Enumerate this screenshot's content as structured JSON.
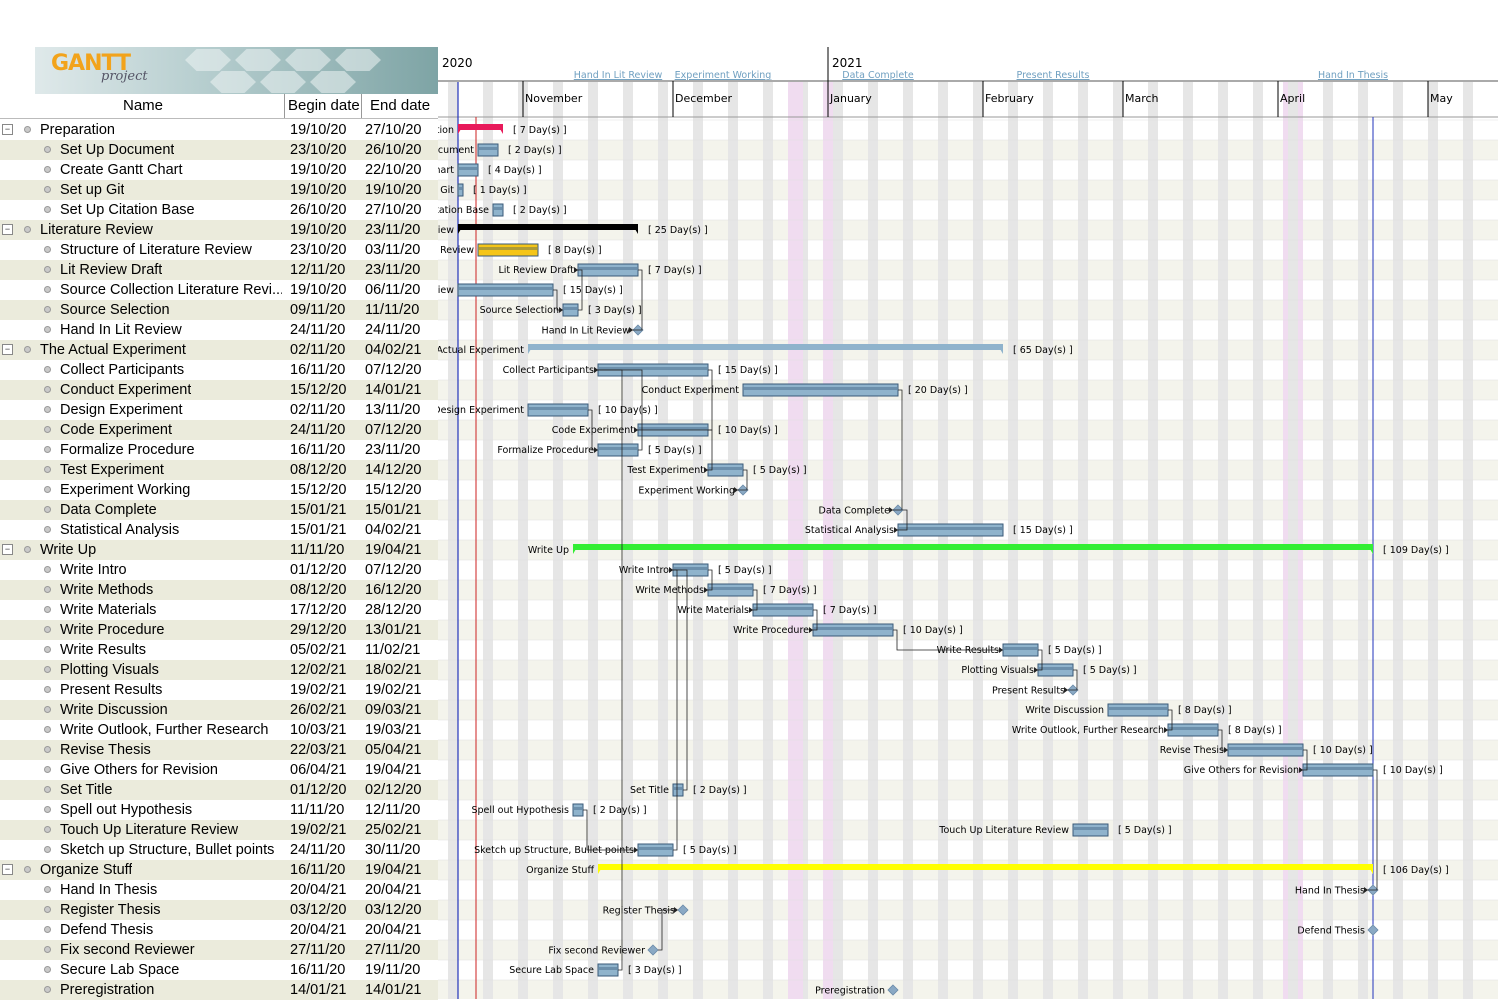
{
  "logo": {
    "word1": "GANTT",
    "word2": "project"
  },
  "table": {
    "headers": {
      "name": "Name",
      "begin": "Begin date",
      "end": "End date"
    },
    "rows": [
      {
        "level": 0,
        "name": "Preparation",
        "begin": "19/10/20",
        "end": "27/10/20"
      },
      {
        "level": 1,
        "name": "Set Up Document",
        "begin": "23/10/20",
        "end": "26/10/20"
      },
      {
        "level": 1,
        "name": "Create Gantt Chart",
        "begin": "19/10/20",
        "end": "22/10/20"
      },
      {
        "level": 1,
        "name": "Set up Git",
        "begin": "19/10/20",
        "end": "19/10/20"
      },
      {
        "level": 1,
        "name": "Set Up Citation Base",
        "begin": "26/10/20",
        "end": "27/10/20"
      },
      {
        "level": 0,
        "name": "Literature Review",
        "begin": "19/10/20",
        "end": "23/11/20"
      },
      {
        "level": 1,
        "name": "Structure of Literature Review",
        "begin": "23/10/20",
        "end": "03/11/20"
      },
      {
        "level": 1,
        "name": "Lit Review Draft",
        "begin": "12/11/20",
        "end": "23/11/20"
      },
      {
        "level": 1,
        "name": "Source Collection Literature Revi...",
        "begin": "19/10/20",
        "end": "06/11/20"
      },
      {
        "level": 1,
        "name": "Source Selection",
        "begin": "09/11/20",
        "end": "11/11/20"
      },
      {
        "level": 1,
        "name": "Hand In Lit Review",
        "begin": "24/11/20",
        "end": "24/11/20"
      },
      {
        "level": 0,
        "name": "The Actual Experiment",
        "begin": "02/11/20",
        "end": "04/02/21"
      },
      {
        "level": 1,
        "name": "Collect Participants",
        "begin": "16/11/20",
        "end": "07/12/20"
      },
      {
        "level": 1,
        "name": "Conduct Experiment",
        "begin": "15/12/20",
        "end": "14/01/21"
      },
      {
        "level": 1,
        "name": "Design Experiment",
        "begin": "02/11/20",
        "end": "13/11/20"
      },
      {
        "level": 1,
        "name": "Code Experiment",
        "begin": "24/11/20",
        "end": "07/12/20"
      },
      {
        "level": 1,
        "name": "Formalize Procedure",
        "begin": "16/11/20",
        "end": "23/11/20"
      },
      {
        "level": 1,
        "name": "Test Experiment",
        "begin": "08/12/20",
        "end": "14/12/20"
      },
      {
        "level": 1,
        "name": "Experiment Working",
        "begin": "15/12/20",
        "end": "15/12/20"
      },
      {
        "level": 1,
        "name": "Data Complete",
        "begin": "15/01/21",
        "end": "15/01/21"
      },
      {
        "level": 1,
        "name": "Statistical Analysis",
        "begin": "15/01/21",
        "end": "04/02/21"
      },
      {
        "level": 0,
        "name": "Write Up",
        "begin": "11/11/20",
        "end": "19/04/21"
      },
      {
        "level": 1,
        "name": "Write Intro",
        "begin": "01/12/20",
        "end": "07/12/20"
      },
      {
        "level": 1,
        "name": "Write Methods",
        "begin": "08/12/20",
        "end": "16/12/20"
      },
      {
        "level": 1,
        "name": "Write Materials",
        "begin": "17/12/20",
        "end": "28/12/20"
      },
      {
        "level": 1,
        "name": "Write Procedure",
        "begin": "29/12/20",
        "end": "13/01/21"
      },
      {
        "level": 1,
        "name": "Write Results",
        "begin": "05/02/21",
        "end": "11/02/21"
      },
      {
        "level": 1,
        "name": "Plotting Visuals",
        "begin": "12/02/21",
        "end": "18/02/21"
      },
      {
        "level": 1,
        "name": "Present Results",
        "begin": "19/02/21",
        "end": "19/02/21"
      },
      {
        "level": 1,
        "name": "Write Discussion",
        "begin": "26/02/21",
        "end": "09/03/21"
      },
      {
        "level": 1,
        "name": "Write Outlook, Further Research",
        "begin": "10/03/21",
        "end": "19/03/21"
      },
      {
        "level": 1,
        "name": "Revise Thesis",
        "begin": "22/03/21",
        "end": "05/04/21"
      },
      {
        "level": 1,
        "name": "Give Others for Revision",
        "begin": "06/04/21",
        "end": "19/04/21"
      },
      {
        "level": 1,
        "name": "Set Title",
        "begin": "01/12/20",
        "end": "02/12/20"
      },
      {
        "level": 1,
        "name": "Spell out Hypothesis",
        "begin": "11/11/20",
        "end": "12/11/20"
      },
      {
        "level": 1,
        "name": "Touch Up Literature Review",
        "begin": "19/02/21",
        "end": "25/02/21"
      },
      {
        "level": 1,
        "name": "Sketch up Structure, Bullet points",
        "begin": "24/11/20",
        "end": "30/11/20"
      },
      {
        "level": 0,
        "name": "Organize Stuff",
        "begin": "16/11/20",
        "end": "19/04/21"
      },
      {
        "level": 1,
        "name": "Hand In Thesis",
        "begin": "20/04/21",
        "end": "20/04/21"
      },
      {
        "level": 1,
        "name": "Register Thesis",
        "begin": "03/12/20",
        "end": "03/12/20"
      },
      {
        "level": 1,
        "name": "Defend Thesis",
        "begin": "20/04/21",
        "end": "20/04/21"
      },
      {
        "level": 1,
        "name": "Fix second Reviewer",
        "begin": "27/11/20",
        "end": "27/11/20"
      },
      {
        "level": 1,
        "name": "Secure Lab Space",
        "begin": "16/11/20",
        "end": "19/11/20"
      },
      {
        "level": 1,
        "name": "Preregistration",
        "begin": "14/01/21",
        "end": "14/01/21"
      }
    ]
  },
  "timeline": {
    "years": [
      "2020",
      "2021"
    ],
    "months": [
      "November",
      "December",
      "January",
      "February",
      "March",
      "April",
      "May"
    ],
    "start_date": "2020-10-19",
    "today_label_note": "",
    "top_milestones": [
      "Hand In Lit Review",
      "Experiment Working",
      "Data Complete",
      "Present Results",
      "Hand In Thesis"
    ]
  },
  "chart_bars": [
    {
      "row": 0,
      "type": "summary",
      "label": "Preparation",
      "start": "2020-10-19",
      "end": "2020-10-27",
      "dur": "[ 7 Day(s) ]",
      "color": "#e8195a"
    },
    {
      "row": 1,
      "type": "task",
      "label": "Set Up Document",
      "start": "2020-10-23",
      "end": "2020-10-26",
      "dur": "[ 2 Day(s) ]"
    },
    {
      "row": 2,
      "type": "task",
      "label": "Create Gantt Chart",
      "start": "2020-10-19",
      "end": "2020-10-22",
      "dur": "[ 4 Day(s) ]"
    },
    {
      "row": 3,
      "type": "task",
      "label": "Set up Git",
      "start": "2020-10-19",
      "end": "2020-10-19",
      "dur": "[ 1 Day(s) ]"
    },
    {
      "row": 4,
      "type": "task",
      "label": "Set Up Citation Base",
      "start": "2020-10-26",
      "end": "2020-10-27",
      "dur": "[ 2 Day(s) ]"
    },
    {
      "row": 5,
      "type": "summary",
      "label": "Literature Review",
      "start": "2020-10-19",
      "end": "2020-11-23",
      "dur": "[ 25 Day(s) ]",
      "color": "#000000"
    },
    {
      "row": 6,
      "type": "task",
      "label": "Structure of Literature Review",
      "start": "2020-10-23",
      "end": "2020-11-03",
      "dur": "[ 8 Day(s) ]",
      "color": "#f5c518"
    },
    {
      "row": 7,
      "type": "task",
      "label": "Lit Review Draft",
      "start": "2020-11-12",
      "end": "2020-11-23",
      "dur": "[ 7 Day(s) ]"
    },
    {
      "row": 8,
      "type": "task",
      "label": "Source Collection Literature Review",
      "start": "2020-10-19",
      "end": "2020-11-06",
      "dur": "[ 15 Day(s) ]"
    },
    {
      "row": 9,
      "type": "task",
      "label": "Source Selection",
      "start": "2020-11-09",
      "end": "2020-11-11",
      "dur": "[ 3 Day(s) ]"
    },
    {
      "row": 10,
      "type": "milestone",
      "label": "Hand In Lit Review",
      "start": "2020-11-24"
    },
    {
      "row": 11,
      "type": "summary",
      "label": "The Actual Experiment",
      "start": "2020-11-02",
      "end": "2021-02-04",
      "dur": "[ 65 Day(s) ]",
      "color": "#8fb3cc"
    },
    {
      "row": 12,
      "type": "task",
      "label": "Collect Participants",
      "start": "2020-11-16",
      "end": "2020-12-07",
      "dur": "[ 15 Day(s) ]"
    },
    {
      "row": 13,
      "type": "task",
      "label": "Conduct Experiment",
      "start": "2020-12-15",
      "end": "2021-01-14",
      "dur": "[ 20 Day(s) ]"
    },
    {
      "row": 14,
      "type": "task",
      "label": "Design Experiment",
      "start": "2020-11-02",
      "end": "2020-11-13",
      "dur": "[ 10 Day(s) ]"
    },
    {
      "row": 15,
      "type": "task",
      "label": "Code Experiment",
      "start": "2020-11-24",
      "end": "2020-12-07",
      "dur": "[ 10 Day(s) ]"
    },
    {
      "row": 16,
      "type": "task",
      "label": "Formalize Procedure",
      "start": "2020-11-16",
      "end": "2020-11-23",
      "dur": "[ 5 Day(s) ]"
    },
    {
      "row": 17,
      "type": "task",
      "label": "Test Experiment",
      "start": "2020-12-08",
      "end": "2020-12-14",
      "dur": "[ 5 Day(s) ]"
    },
    {
      "row": 18,
      "type": "milestone",
      "label": "Experiment Working",
      "start": "2020-12-15"
    },
    {
      "row": 19,
      "type": "milestone",
      "label": "Data Complete",
      "start": "2021-01-15"
    },
    {
      "row": 20,
      "type": "task",
      "label": "Statistical Analysis",
      "start": "2021-01-15",
      "end": "2021-02-04",
      "dur": "[ 15 Day(s) ]"
    },
    {
      "row": 21,
      "type": "summary",
      "label": "Write Up",
      "start": "2020-11-11",
      "end": "2021-04-19",
      "dur": "[ 109 Day(s) ]",
      "color": "#33ee33"
    },
    {
      "row": 22,
      "type": "task",
      "label": "Write Intro",
      "start": "2020-12-01",
      "end": "2020-12-07",
      "dur": "[ 5 Day(s) ]"
    },
    {
      "row": 23,
      "type": "task",
      "label": "Write Methods",
      "start": "2020-12-08",
      "end": "2020-12-16",
      "dur": "[ 7 Day(s) ]"
    },
    {
      "row": 24,
      "type": "task",
      "label": "Write Materials",
      "start": "2020-12-17",
      "end": "2020-12-28",
      "dur": "[ 7 Day(s) ]"
    },
    {
      "row": 25,
      "type": "task",
      "label": "Write Procedure",
      "start": "2020-12-29",
      "end": "2021-01-13",
      "dur": "[ 10 Day(s) ]"
    },
    {
      "row": 26,
      "type": "task",
      "label": "Write Results",
      "start": "2021-02-05",
      "end": "2021-02-11",
      "dur": "[ 5 Day(s) ]"
    },
    {
      "row": 27,
      "type": "task",
      "label": "Plotting Visuals",
      "start": "2021-02-12",
      "end": "2021-02-18",
      "dur": "[ 5 Day(s) ]"
    },
    {
      "row": 28,
      "type": "milestone",
      "label": "Present Results",
      "start": "2021-02-19"
    },
    {
      "row": 29,
      "type": "task",
      "label": "Write Discussion",
      "start": "2021-02-26",
      "end": "2021-03-09",
      "dur": "[ 8 Day(s) ]"
    },
    {
      "row": 30,
      "type": "task",
      "label": "Write Outlook, Further Research",
      "start": "2021-03-10",
      "end": "2021-03-19",
      "dur": "[ 8 Day(s) ]"
    },
    {
      "row": 31,
      "type": "task",
      "label": "Revise Thesis",
      "start": "2021-03-22",
      "end": "2021-04-05",
      "dur": "[ 10 Day(s) ]"
    },
    {
      "row": 32,
      "type": "task",
      "label": "Give Others for Revision",
      "start": "2021-04-06",
      "end": "2021-04-19",
      "dur": "[ 10 Day(s) ]"
    },
    {
      "row": 33,
      "type": "task",
      "label": "Set Title",
      "start": "2020-12-01",
      "end": "2020-12-02",
      "dur": "[ 2 Day(s) ]"
    },
    {
      "row": 34,
      "type": "task",
      "label": "Spell out Hypothesis",
      "start": "2020-11-11",
      "end": "2020-11-12",
      "dur": "[ 2 Day(s) ]"
    },
    {
      "row": 35,
      "type": "task",
      "label": "Touch Up Literature Review",
      "start": "2021-02-19",
      "end": "2021-02-25",
      "dur": "[ 5 Day(s) ]"
    },
    {
      "row": 36,
      "type": "task",
      "label": "Sketch up Structure, Bullet points",
      "start": "2020-11-24",
      "end": "2020-11-30",
      "dur": "[ 5 Day(s) ]"
    },
    {
      "row": 37,
      "type": "summary",
      "label": "Organize Stuff",
      "start": "2020-11-16",
      "end": "2021-04-19",
      "dur": "[ 106 Day(s) ]",
      "color": "#ffff00"
    },
    {
      "row": 38,
      "type": "milestone",
      "label": "Hand In Thesis",
      "start": "2021-04-20"
    },
    {
      "row": 39,
      "type": "milestone",
      "label": "Register Thesis",
      "start": "2020-12-03"
    },
    {
      "row": 40,
      "type": "milestone",
      "label": "Defend Thesis",
      "start": "2021-04-20"
    },
    {
      "row": 41,
      "type": "milestone",
      "label": "Fix second Reviewer",
      "start": "2020-11-27"
    },
    {
      "row": 42,
      "type": "task",
      "label": "Secure Lab Space",
      "start": "2020-11-16",
      "end": "2020-11-19",
      "dur": "[ 3 Day(s) ]"
    },
    {
      "row": 43,
      "type": "milestone",
      "label": "Preregistration",
      "start": "2021-01-14"
    }
  ],
  "colors": {
    "task_bar": "#8fb3cc",
    "task_bar_border": "#3a5a78",
    "milestone": "#8aa9c4",
    "weekend": "#e6e6e6",
    "holiday": "#f0dcf0",
    "row_alt": "#ebebdc"
  }
}
